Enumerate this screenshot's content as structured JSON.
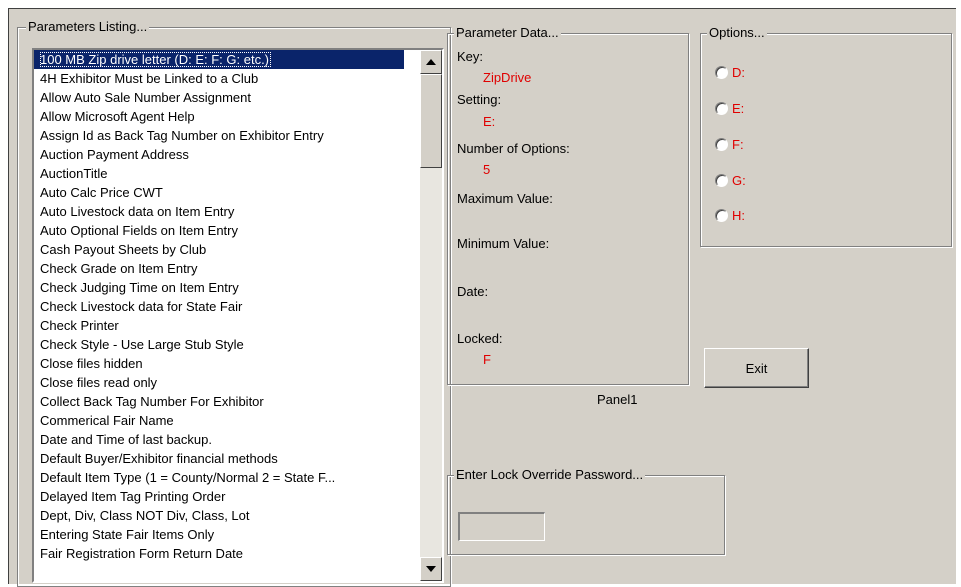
{
  "parameters_listing": {
    "title": "Parameters Listing...",
    "items": [
      "100 MB Zip drive letter (D: E: F: G: etc.)",
      "4H Exhibitor Must be Linked to a Club",
      "Allow Auto Sale Number Assignment",
      "Allow Microsoft Agent Help",
      "Assign Id as Back Tag Number on Exhibitor Entry",
      "Auction Payment Address",
      "AuctionTitle",
      "Auto Calc Price CWT",
      "Auto Livestock data on Item Entry",
      "Auto Optional Fields on Item Entry",
      "Cash Payout Sheets by Club",
      "Check Grade on Item Entry",
      "Check Judging Time on Item Entry",
      "Check Livestock data for State Fair",
      "Check Printer",
      "Check Style - Use Large Stub Style",
      "Close files hidden",
      "Close files read only",
      "Collect Back Tag Number For Exhibitor",
      "Commerical Fair Name",
      "Date and Time of last backup.",
      "Default Buyer/Exhibitor financial methods",
      "Default Item Type (1 = County/Normal  2 = State F...",
      "Delayed Item Tag Printing Order",
      "Dept, Div, Class NOT Div, Class, Lot",
      "Entering State Fair Items Only",
      "Fair Registration Form Return Date"
    ],
    "selected_index": 0
  },
  "parameter_data": {
    "title": "Parameter Data...",
    "key_label": "Key:",
    "key_value": "ZipDrive",
    "setting_label": "Setting:",
    "setting_value": "E:",
    "num_options_label": "Number of Options:",
    "num_options_value": "5",
    "max_label": "Maximum Value:",
    "max_value": "",
    "min_label": "Minimum Value:",
    "min_value": "",
    "date_label": "Date:",
    "date_value": "",
    "locked_label": "Locked:",
    "locked_value": "F"
  },
  "panel_label": "Panel1",
  "options": {
    "title": "Options...",
    "items": [
      "D:",
      "E:",
      "F:",
      "G:",
      "H:"
    ]
  },
  "exit_label": "Exit",
  "lock_override": {
    "title": "Enter Lock Override Password...",
    "value": ""
  },
  "colors": {
    "value_text": "#e00000",
    "selection": "#0a246a",
    "face": "#d4d0c8"
  }
}
